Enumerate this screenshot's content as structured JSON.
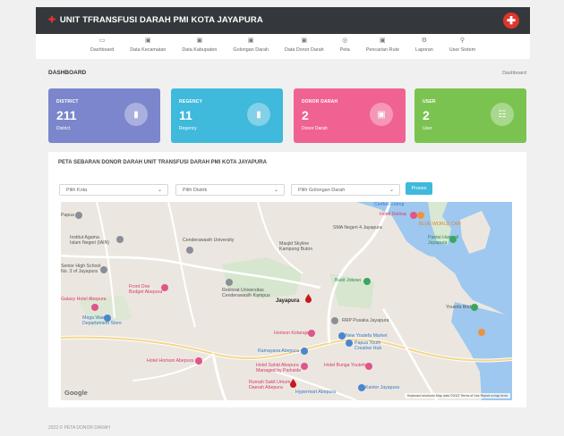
{
  "app": {
    "title": "UNIT TFRANSFUSI DARAH PMI KOTA JAYAPURA"
  },
  "nav": [
    {
      "label": "Dashboard",
      "icon": "monitor-icon",
      "glyph": "▭"
    },
    {
      "label": "Data Kecamatan",
      "icon": "briefcase-icon",
      "glyph": "▣"
    },
    {
      "label": "Data Kabupaten",
      "icon": "briefcase-icon",
      "glyph": "▣"
    },
    {
      "label": "Golongan Darah",
      "icon": "briefcase-icon",
      "glyph": "▣"
    },
    {
      "label": "Data Donor Darah",
      "icon": "briefcase-icon",
      "glyph": "▣"
    },
    {
      "label": "Peta",
      "icon": "map-pin-icon",
      "glyph": "◎"
    },
    {
      "label": "Pencarian Rute",
      "icon": "briefcase-icon",
      "glyph": "▣"
    },
    {
      "label": "Laporan",
      "icon": "settings-icon",
      "glyph": "⚙"
    },
    {
      "label": "User Sistem",
      "icon": "user-icon",
      "glyph": "⚲"
    }
  ],
  "page": {
    "title": "DASHBOARD",
    "breadcrumb": "Dashboard"
  },
  "cards": [
    {
      "title": "DISTRICT",
      "value": "211",
      "sub": "District",
      "icon": "briefcase-icon",
      "glyph": "▮"
    },
    {
      "title": "REGENCY",
      "value": "11",
      "sub": "Regency",
      "icon": "briefcase-icon",
      "glyph": "▮"
    },
    {
      "title": "DONOR DARAH",
      "value": "2",
      "sub": "Donor Darah",
      "icon": "card-icon",
      "glyph": "▣"
    },
    {
      "title": "USER",
      "value": "2",
      "sub": "User",
      "icon": "users-icon",
      "glyph": "☷"
    }
  ],
  "map_panel": {
    "title": "PETA SEBARAN DONOR DARAH UNIT TRANSFUSI DARAH PMI KOTA JAYAPURA",
    "filters": [
      {
        "placeholder": "Pilih Kota"
      },
      {
        "placeholder": "Pilih Distrik"
      },
      {
        "placeholder": "Pilih Golongan Darah"
      }
    ],
    "button": "Proses"
  },
  "map": {
    "labels": {
      "l1": "Papua",
      "l2": "Institut Agama\nIslam Negeri (IAIN)",
      "l3": "Cenderawasih University",
      "l4": "Masjid Skyline\nKampung Buton",
      "l5": "SMA Negeri 4 Jayapura",
      "l6": "Hotel Delima",
      "l7": "Pantai Hamadi\nJayapura",
      "l8": "Senior High School\nNo. 3 of Jayapura",
      "l9": "Rektorat Universitas\nCenderawasih Kampus",
      "l10": "Front One\nBudget Abepura",
      "l11": "Galaxy Hotel Abepura",
      "l12": "Bukit Jokowi",
      "l13": "Jayapura",
      "l14": "Mega Waena\nDepartement Store",
      "l15": "RRP Pusaka Jayapura",
      "l16": "Youtefa Bridge",
      "l17": "Horison Kotaraja",
      "l18": "New Youtefa Market",
      "l19": "Papua Youth\nCreative Hub",
      "l20": "Ramayana Abepura",
      "l21": "Hotel Horison Abepura",
      "l22": "Hotel Sahid Abepura\nManaged by Parkside",
      "l23": "Hotel Bunga Youtefa",
      "l24": "Rumah Sakit Umum\nDaerah Abepura",
      "l25": "Hypermart Abepura",
      "l26": "Kantor Jayapura",
      "l27": "Cenfuri Entrop",
      "l28": "BLUE WORLD CAR"
    },
    "attribution": "Keyboard shortcuts   Map data ©2022   Terms of Use   Report a map error",
    "google": "Google"
  },
  "footer": "2022 © PETA DONOR DARAH"
}
